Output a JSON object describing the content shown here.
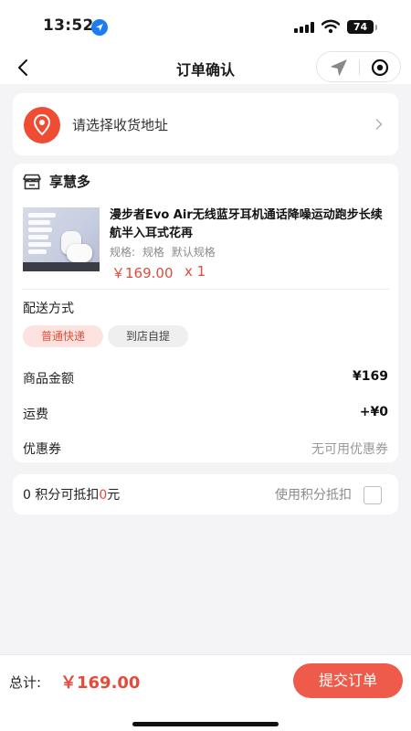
{
  "status_bar": {
    "time": "13:52",
    "battery": "74"
  },
  "nav": {
    "title": "订单确认"
  },
  "address": {
    "placeholder_text": "请选择收货地址",
    "icon": "location-pin-icon",
    "accent": "#ef4c34"
  },
  "shop": {
    "name": "享慧多",
    "icon": "store-icon"
  },
  "product": {
    "title": "漫步者Evo Air无线蓝牙耳机通话降噪运动跑步长续航半入耳式花再",
    "spec_label": "规格:",
    "spec_key": "规格",
    "spec_value": "默认规格",
    "price": "￥169.00",
    "quantity": "x 1"
  },
  "delivery": {
    "label": "配送方式",
    "options": [
      {
        "label": "普通快递",
        "selected": true
      },
      {
        "label": "到店自提",
        "selected": false
      }
    ]
  },
  "summary": [
    {
      "label": "商品金额",
      "value": "¥169"
    },
    {
      "label": "运费",
      "value": "+¥0"
    },
    {
      "label": "优惠券",
      "value": "无可用优惠券"
    }
  ],
  "points": {
    "count": "0",
    "text_before": " 积分可抵扣",
    "deduct_amount": "0",
    "text_after": "元",
    "use_label": "使用积分抵扣",
    "checked": false
  },
  "footer": {
    "total_label": "总计:",
    "total_value": "￥169.00",
    "submit_label": "提交订单"
  },
  "colors": {
    "accent_red": "#e34b3b",
    "button_red": "#ee5b4a",
    "background": "#f4f4f6"
  }
}
